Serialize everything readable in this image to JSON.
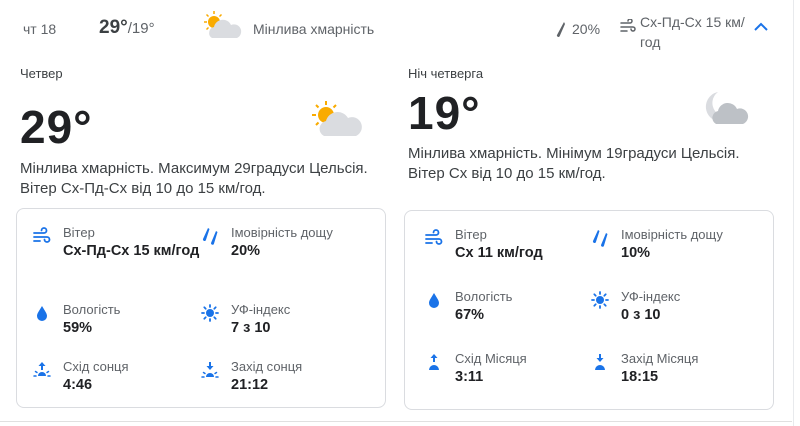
{
  "summary": {
    "day": "чт 18",
    "high": "29°",
    "low": "/19°",
    "condition": "Мінлива хмарність",
    "rain_chance": "20%",
    "wind": "Сх-Пд-Сх 15 км/год"
  },
  "day": {
    "title": "Четвер",
    "temp": "29°",
    "description": "Мінлива хмарність. Максимум 29градуси Цельсія. Вітер Сх-Пд-Сх від 10 до 15 км/год.",
    "details": {
      "wind_label": "Вітер",
      "wind_value": "Сх-Пд-Сх 15 км/год",
      "rain_label": "Імовірність дощу",
      "rain_value": "20%",
      "humidity_label": "Вологість",
      "humidity_value": "59%",
      "uv_label": "УФ-індекс",
      "uv_value": "7 з 10",
      "rise_label": "Схід сонця",
      "rise_value": "4:46",
      "set_label": "Захід сонця",
      "set_value": "21:12"
    }
  },
  "night": {
    "title": "Ніч четверга",
    "temp": "19°",
    "description": "Мінлива хмарність. Мінімум 19градуси Цельсія. Вітер Сх від 10 до 15 км/год.",
    "details": {
      "wind_label": "Вітер",
      "wind_value": "Сх 11 км/год",
      "rain_label": "Імовірність дощу",
      "rain_value": "10%",
      "humidity_label": "Вологість",
      "humidity_value": "67%",
      "uv_label": "УФ-індекс",
      "uv_value": "0 з 10",
      "rise_label": "Схід Місяця",
      "rise_value": "3:11",
      "set_label": "Захід Місяця",
      "set_value": "18:15"
    }
  },
  "colors": {
    "accent": "#1a73e8",
    "sun": "#f9ab00",
    "cloud": "#dadce0"
  },
  "icons": [
    "partly-cloudy-icon",
    "raindrop-icon",
    "wind-icon",
    "chevron-up-icon",
    "moon-cloud-icon",
    "humidity-icon",
    "uv-icon",
    "sunrise-icon",
    "sunset-icon",
    "moonrise-icon",
    "moonset-icon"
  ]
}
